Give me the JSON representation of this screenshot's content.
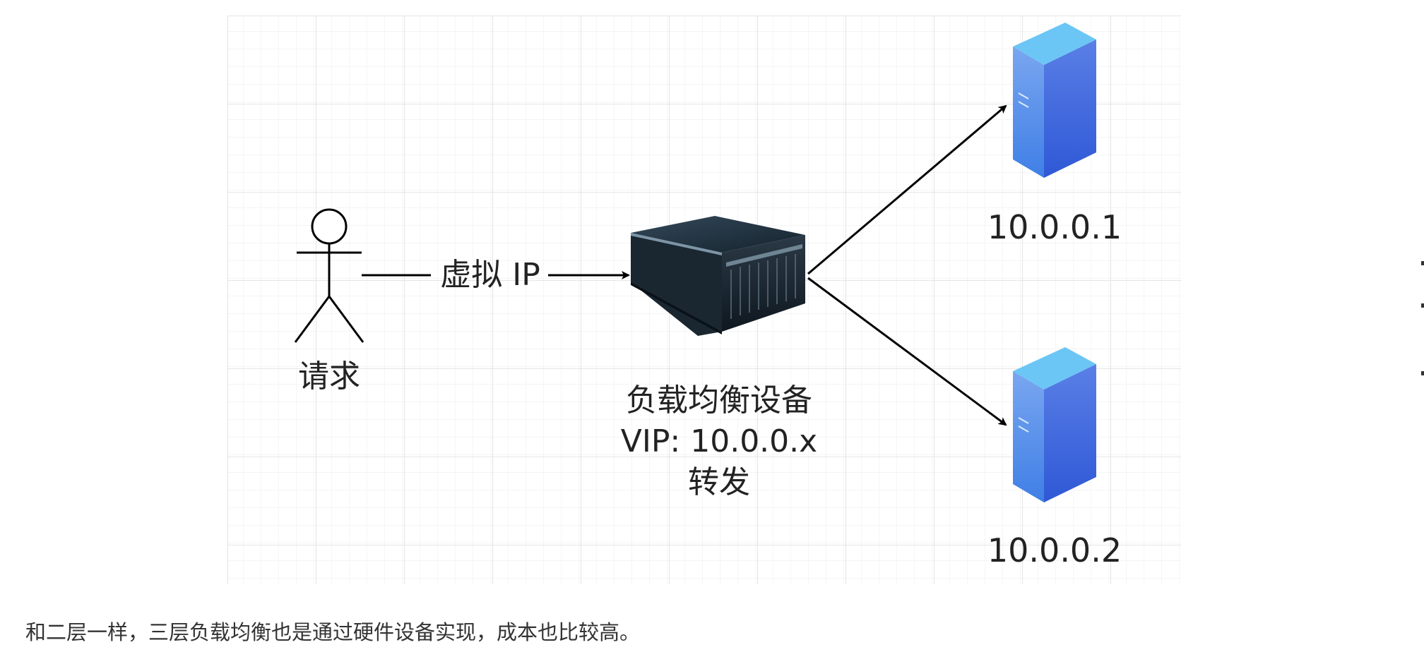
{
  "diagram": {
    "actor_label": "请求",
    "edge_label": "虚拟 IP",
    "lb_label_line1": "负载均衡设备",
    "lb_label_line2": "VIP: 10.0.0.x",
    "lb_label_line3": "转发",
    "server1_label": "10.0.0.1",
    "server2_label": "10.0.0.2"
  },
  "caption": "和二层一样，三层负载均衡也是通过硬件设备实现，成本也比较高。",
  "colors": {
    "grid": "#e3e3e3",
    "server_front": "#3f66d8",
    "server_top": "#63b6f2",
    "server_side": "#2547a7",
    "arrow": "#000000",
    "text": "#222222"
  },
  "icons": {
    "actor": "stick-figure-icon",
    "load_balancer": "rack-server-icon",
    "server": "tower-server-icon"
  }
}
